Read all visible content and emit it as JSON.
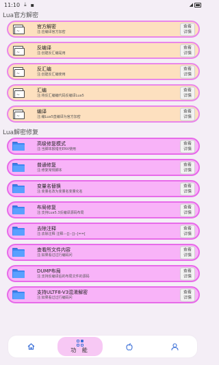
{
  "status_bar": {
    "time": "11:10"
  },
  "sections": [
    {
      "title": "Lua官方解密",
      "style": "orange",
      "icon": "file",
      "items": [
        {
          "title": "官方解密",
          "sub": "注:应编译官方加密"
        },
        {
          "title": "反编译",
          "sub": "注:创建反汇编是用"
        },
        {
          "title": "反汇编",
          "sub": "注:创建反汇编使用"
        },
        {
          "title": "汇编",
          "sub": "注:将反汇编编代码反编译Lua5"
        },
        {
          "title": "编译",
          "sub": "注:编Lua5直编译为官方加密"
        }
      ]
    },
    {
      "title": "Lua解密修复",
      "style": "pink",
      "icon": "folder",
      "items": [
        {
          "title": "高级修复模式",
          "sub": "注:当脚本报错无ENV使用"
        },
        {
          "title": "普通修复",
          "sub": "注:修复常规脚本"
        },
        {
          "title": "变量名替换",
          "sub": "注:变量名改为变量名变量化名"
        },
        {
          "title": "布局修复",
          "sub": "注:支持Lua5.3反编译源码布局"
        },
        {
          "title": "去除注释",
          "sub": "注:去除注释 注释:--[[--]]--[==["
        },
        {
          "title": "查看所文件内容",
          "sub": "注:如果看过过行编码问"
        },
        {
          "title": "DUMP布局",
          "sub": "注:支持反编译后的布局文件的源码"
        },
        {
          "title": "支持ULTF8-V3混淆解密",
          "sub": "注:如果看过过行编码问"
        }
      ]
    }
  ],
  "detail_label_top": "查看",
  "detail_label_bottom": "详情",
  "bottom_nav": {
    "active_label": "功 能"
  }
}
